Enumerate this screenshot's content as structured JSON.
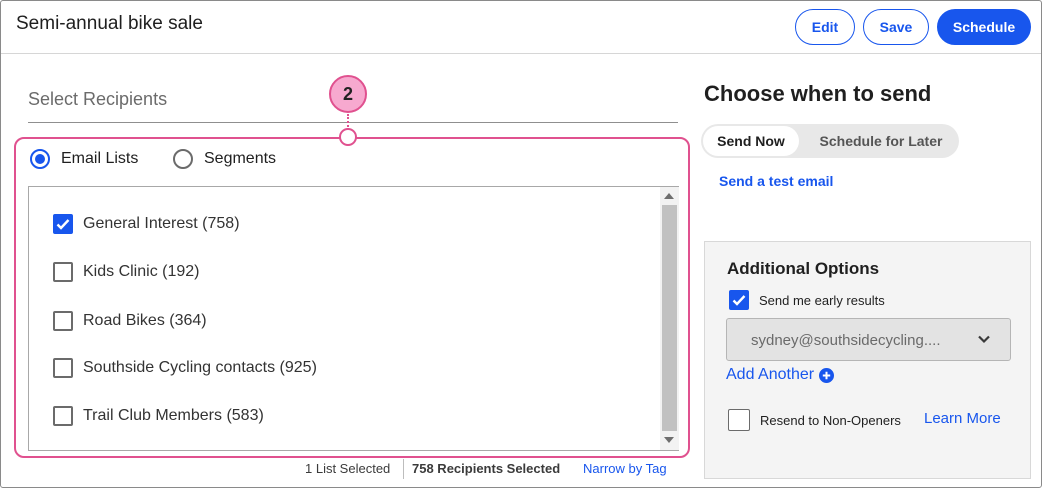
{
  "header": {
    "title": "Semi-annual bike sale",
    "edit_label": "Edit",
    "save_label": "Save",
    "schedule_label": "Schedule"
  },
  "recipients": {
    "heading": "Select Recipients",
    "callout_number": "2",
    "radio_options": [
      {
        "label": "Email Lists",
        "selected": true
      },
      {
        "label": "Segments",
        "selected": false
      }
    ],
    "lists": [
      {
        "label": "General Interest (758)",
        "checked": true
      },
      {
        "label": "Kids Clinic (192)",
        "checked": false
      },
      {
        "label": "Road Bikes (364)",
        "checked": false
      },
      {
        "label": "Southside Cycling contacts (925)",
        "checked": false
      },
      {
        "label": "Trail Club Members (583)",
        "checked": false
      }
    ],
    "summary": {
      "lists_selected": "1 List Selected",
      "recipients_selected": "758 Recipients Selected",
      "narrow_link": "Narrow by Tag"
    }
  },
  "send": {
    "heading": "Choose when to send",
    "tabs": [
      {
        "label": "Send Now",
        "active": true
      },
      {
        "label": "Schedule for Later",
        "active": false
      }
    ],
    "test_email_link": "Send a test email"
  },
  "options": {
    "title": "Additional Options",
    "early_results_label": "Send me early results",
    "early_results_checked": true,
    "email_value": "sydney@southsidecycling....",
    "add_another_label": "Add Another",
    "resend_label": "Resend to Non-Openers",
    "resend_checked": false,
    "learn_more_label": "Learn More"
  },
  "colors": {
    "accent": "#1856ed",
    "callout": "#e0518f",
    "callout_fill": "#f7a9cf"
  }
}
